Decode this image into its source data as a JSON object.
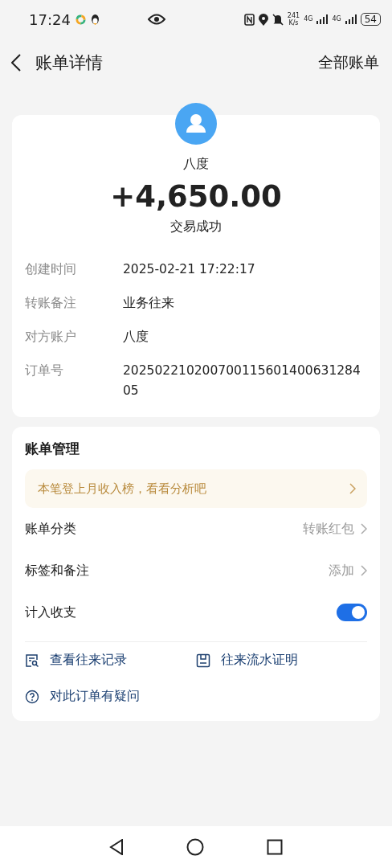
{
  "status_bar": {
    "time": "17:24",
    "speed_value": "241",
    "speed_unit": "K/s",
    "network_labels": [
      "4G",
      "4G"
    ],
    "battery": "54"
  },
  "header": {
    "title": "账单详情",
    "action": "全部账单"
  },
  "summary": {
    "name": "八度",
    "amount": "+4,650.00",
    "status": "交易成功"
  },
  "details": [
    {
      "label": "创建时间",
      "value": "2025-02-21 17:22:17"
    },
    {
      "label": "转账备注",
      "value": "业务往来"
    },
    {
      "label": "对方账户",
      "value": "八度"
    },
    {
      "label": "订单号",
      "value": "20250221020070011560140063128405"
    }
  ],
  "management": {
    "title": "账单管理",
    "banner": "本笔登上月收入榜，看看分析吧",
    "rows": [
      {
        "kind": "link",
        "label": "账单分类",
        "value": "转账红包"
      },
      {
        "kind": "link",
        "label": "标签和备注",
        "value": "添加"
      },
      {
        "kind": "toggle",
        "label": "计入收支",
        "on": true
      }
    ],
    "actions": [
      {
        "kind": "records",
        "label": "查看往来记录"
      },
      {
        "kind": "proof",
        "label": "往来流水证明"
      },
      {
        "kind": "help",
        "label": "对此订单有疑问"
      }
    ]
  }
}
